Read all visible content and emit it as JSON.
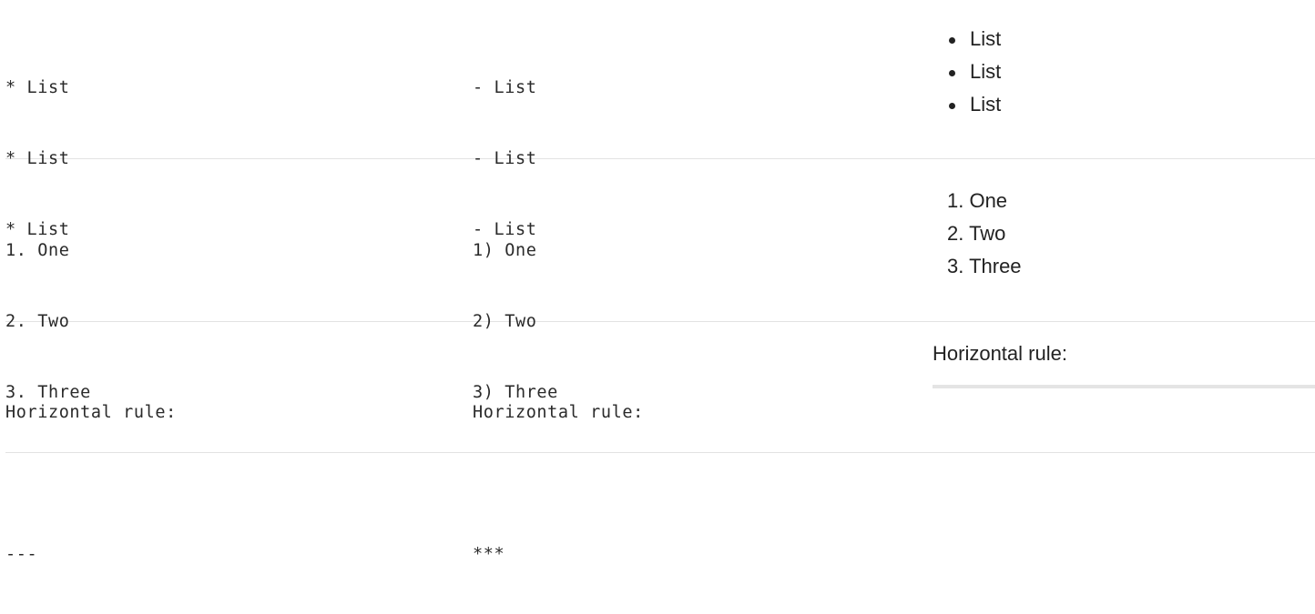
{
  "rows": [
    {
      "raw_a": [
        "* List",
        "* List",
        "* List"
      ],
      "raw_b": [
        "- List",
        "- List",
        "- List"
      ],
      "rendered": [
        "List",
        "List",
        "List"
      ]
    },
    {
      "raw_a": [
        "1. One",
        "2. Two",
        "3. Three"
      ],
      "raw_b": [
        "1) One",
        "2) Two",
        "3) Three"
      ],
      "rendered": [
        "1. One",
        "2. Two",
        "3. Three"
      ]
    },
    {
      "raw_a": [
        "Horizontal rule:",
        "",
        "---"
      ],
      "raw_b": [
        "Horizontal rule:",
        "",
        "***"
      ],
      "rendered_heading": "Horizontal rule:"
    }
  ]
}
